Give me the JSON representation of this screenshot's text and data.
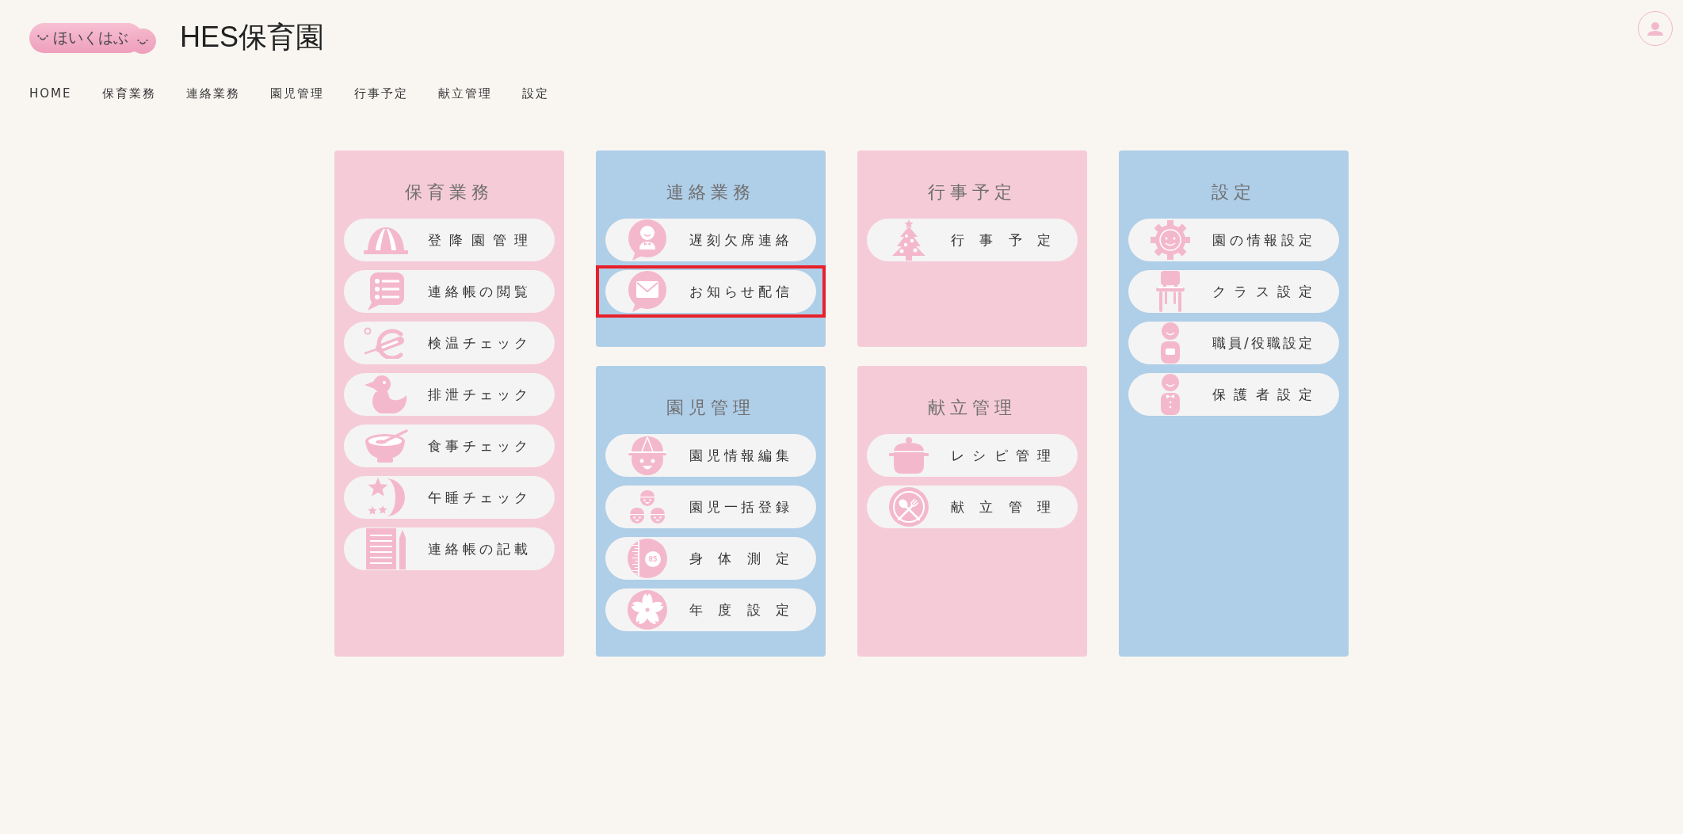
{
  "header": {
    "logo_text": "ほいくはぶ",
    "title": "HES保育園"
  },
  "nav": [
    "HOME",
    "保育業務",
    "連絡業務",
    "園児管理",
    "行事予定",
    "献立管理",
    "設定"
  ],
  "columns": [
    {
      "panels": [
        {
          "title": "保育業務",
          "color": "#f6cbd8",
          "items": [
            {
              "label": "登降園管理",
              "highlighted": false
            },
            {
              "label": "連絡帳の閲覧",
              "highlighted": false
            },
            {
              "label": "検温チェック",
              "highlighted": false
            },
            {
              "label": "排泄チェック",
              "highlighted": false
            },
            {
              "label": "食事チェック",
              "highlighted": false
            },
            {
              "label": "午睡チェック",
              "highlighted": false
            },
            {
              "label": "連絡帳の記載",
              "highlighted": false
            }
          ]
        }
      ]
    },
    {
      "panels": [
        {
          "title": "連絡業務",
          "color": "#afcee8",
          "items": [
            {
              "label": "遅刻欠席連絡",
              "highlighted": false
            },
            {
              "label": "お知らせ配信",
              "highlighted": true
            }
          ]
        },
        {
          "title": "園児管理",
          "color": "#afcee8",
          "items": [
            {
              "label": "園児情報編集",
              "highlighted": false
            },
            {
              "label": "園児一括登録",
              "highlighted": false
            },
            {
              "label": "身体測定",
              "icon_text": "85",
              "highlighted": false
            },
            {
              "label": "年度設定",
              "highlighted": false
            }
          ]
        }
      ]
    },
    {
      "panels": [
        {
          "title": "行事予定",
          "color": "#f6cbd8",
          "items": [
            {
              "label": "行事予定",
              "highlighted": false
            }
          ]
        },
        {
          "title": "献立管理",
          "color": "#f6cbd8",
          "items": [
            {
              "label": "レシピ管理",
              "highlighted": false
            },
            {
              "label": "献立管理",
              "highlighted": false
            }
          ]
        }
      ]
    },
    {
      "panels": [
        {
          "title": "設定",
          "color": "#afcee8",
          "items": [
            {
              "label": "園の情報設定",
              "highlighted": false
            },
            {
              "label": "クラス設定",
              "highlighted": false
            },
            {
              "label": "職員/役職設定",
              "highlighted": false
            },
            {
              "label": "保護者設定",
              "highlighted": false
            }
          ]
        }
      ]
    }
  ]
}
